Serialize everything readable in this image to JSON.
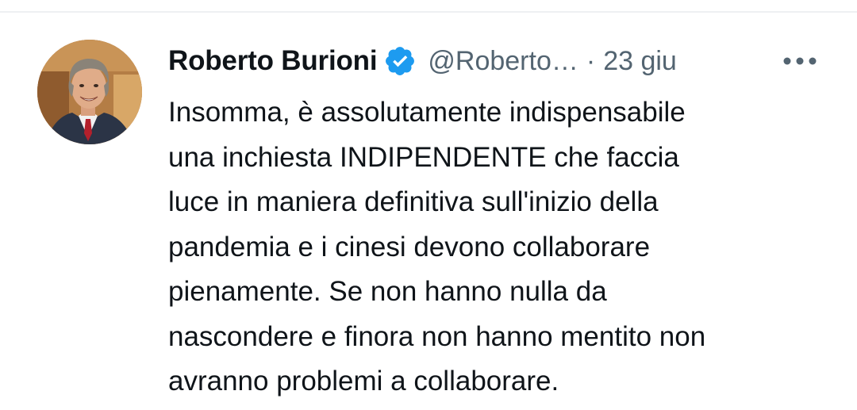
{
  "tweet": {
    "author_name": "Roberto Burioni",
    "handle": "@Roberto…",
    "separator": "·",
    "date": "23 giu",
    "text_lines": [
      "Insomma, è assolutamente indispensabile",
      "una inchiesta INDIPENDENTE che faccia",
      "luce in maniera definitiva sull'inizio della",
      "pandemia e i cinesi devono collaborare",
      "pienamente. Se non hanno nulla da",
      "nascondere e finora non hanno mentito non",
      "avranno problemi a collaborare."
    ]
  },
  "icons": {
    "verified": "verified-badge-icon",
    "more": "more-options-icon"
  },
  "colors": {
    "text_primary": "#0f1419",
    "text_secondary": "#536471",
    "verified_blue": "#1d9bf0",
    "divider": "#eef0f2"
  }
}
